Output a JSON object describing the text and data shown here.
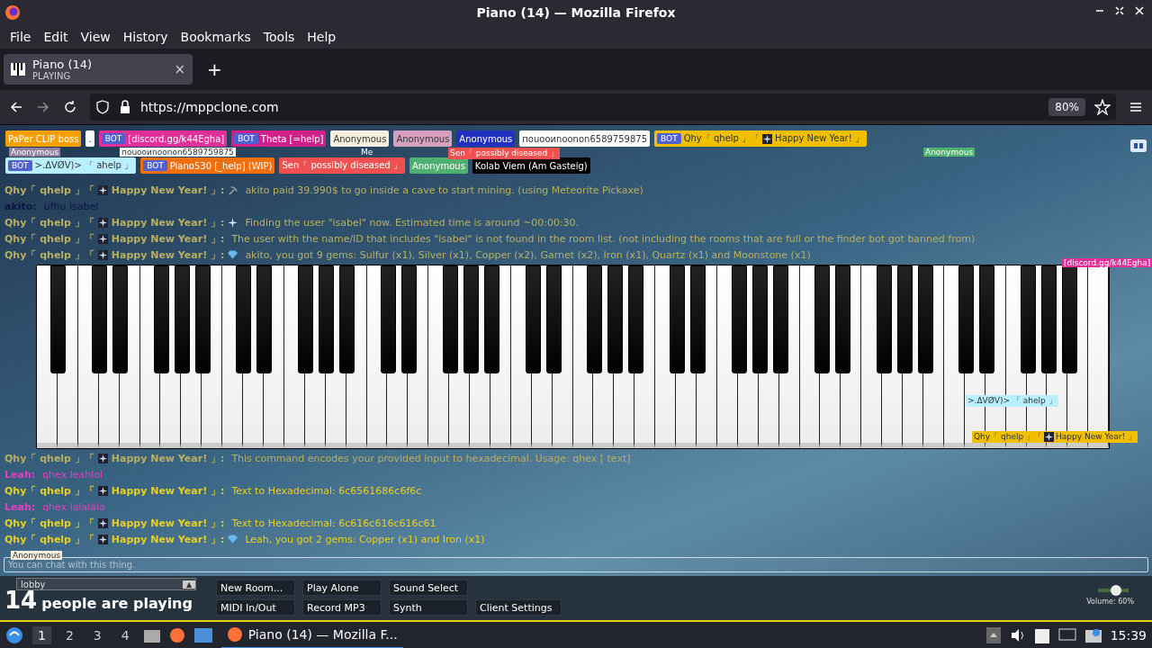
{
  "window": {
    "title": "Piano (14) — Mozilla Firefox"
  },
  "menu": [
    "File",
    "Edit",
    "View",
    "History",
    "Bookmarks",
    "Tools",
    "Help"
  ],
  "tabs": [
    {
      "title": "Piano (14)",
      "subtitle": "PLAYING",
      "selected": true,
      "close": "×"
    }
  ],
  "new_tab": "+",
  "address_bar": {
    "url": "https://mppclone.com",
    "zoom": "80%"
  },
  "users": [
    {
      "text": "PaPer CLIP boss",
      "color": "#f5a000"
    },
    {
      "text": ".",
      "color": "#ffffff"
    },
    {
      "badge": "BOT",
      "text": "[discord.gg/k44Egha]",
      "color": "#e0309a"
    },
    {
      "badge": "BOT",
      "text": "Theta [=help]",
      "color": "#d0208a"
    },
    {
      "text": "Anonymous",
      "color": "#f6efe0"
    },
    {
      "text": "Anonymous",
      "color": "#d8a0c0"
    },
    {
      "text": "Anonymous",
      "color": "#2030c0"
    },
    {
      "text": "поuооиnооnon6589759875",
      "color": "#ffffff"
    },
    {
      "badge": "BOT",
      "text": "Qhy「 qhelp 」「",
      "text_after": "Happy New Year! 」",
      "color": "#f0c000"
    },
    {
      "badge": "BOT",
      "text": ">.ΔVØV)> 「 ahelp 」",
      "color": "#b8f0ff"
    },
    {
      "badge": "BOT",
      "text": "Piano530 [_help] (WIP)",
      "color": "#f07010"
    },
    {
      "text": "Sen「 possibly diseased 」",
      "color": "#f05050"
    },
    {
      "text": "Anonymous",
      "color": "#50b070"
    },
    {
      "text": "Kolab Viem (Am Gasteig)",
      "color": "#000000"
    }
  ],
  "cursors": [
    {
      "text": "Anonymous",
      "color": "#9080a0"
    },
    {
      "text": "поuооиnооnon6589759875",
      "color": "#ffffff"
    },
    {
      "text": "Me"
    },
    {
      "text": "Sen「 possibly diseased 」",
      "color": "#f05050"
    },
    {
      "text": "Anonymous",
      "color": "#50b070"
    },
    {
      "text": "[discord.gg/k44Egha]",
      "color": "#e0309a"
    },
    {
      "text": ">.ΔVØV)> 「 ahelp 」",
      "color": "#b8f0ff"
    },
    {
      "text": "Qhy「 qhelp 」「",
      "text_after": "Happy New Year! 」",
      "color": "#f0c000"
    },
    {
      "text": "Anonymous",
      "color": "#f6efe0"
    }
  ],
  "chat_above": [
    {
      "sender": "Qhy「 qhelp 」「",
      "sender_after": "Happy New Year! 」:",
      "color": "#b8b060",
      "kind": "mining",
      "message": "akito paid 39.990$ to go inside a cave to start mining. (using Meteorite Pickaxe)"
    },
    {
      "sender": "akito:",
      "color": "#0c1448",
      "message": "ufhu isabel"
    },
    {
      "sender": "Qhy「 qhelp 」「",
      "sender_after": "Happy New Year! 」:",
      "color": "#b8b060",
      "kind": "search",
      "message": "Finding the user \"isabel\" now. Estimated time is around ~00:00:30."
    },
    {
      "sender": "Qhy「 qhelp 」「",
      "sender_after": "Happy New Year! 」:",
      "color": "#b8b060",
      "message": "The user with the name/ID that includes \"isabel\" is not found in the room list. (not including the rooms that are full or the finder bot got banned from)"
    },
    {
      "sender": "Qhy「 qhelp 」「",
      "sender_after": "Happy New Year! 」:",
      "color": "#b8b060",
      "kind": "gems",
      "message": "akito, you got 9 gems: Sulfur (x1), Silver (x1), Copper (x2), Garnet (x2), Iron (x1), Quartz (x1) and Moonstone (x1)"
    }
  ],
  "chat_below": [
    {
      "sender": "Qhy「 qhelp 」「",
      "sender_after": "Happy New Year! 」:",
      "color": "#b8b060",
      "message": "This command encodes your provided input to hexadecimal. Usage: qhex [ text]"
    },
    {
      "sender": "Leah:",
      "color": "#e040c0",
      "message": "qhex leahlol"
    },
    {
      "sender": "Qhy「 qhelp 」「",
      "sender_after": "Happy New Year! 」:",
      "color": "#e8d020",
      "message": "Text to Hexadecimal: 6c6561686c6f6c"
    },
    {
      "sender": "Leah:",
      "color": "#e040c0",
      "message": "qhex lalalala"
    },
    {
      "sender": "Qhy「 qhelp 」「",
      "sender_after": "Happy New Year! 」:",
      "color": "#e8d020",
      "message": "Text to Hexadecimal: 6c616c616c616c61"
    },
    {
      "sender": "Qhy「 qhelp 」「",
      "sender_after": "Happy New Year! 」:",
      "color": "#e8d020",
      "kind": "gems",
      "message": "Leah, you got 2 gems: Copper (x1) and Iron (x1)"
    }
  ],
  "chat_input": {
    "placeholder": "You can chat with this thing."
  },
  "room": {
    "value": "lobby",
    "arrow": "▲"
  },
  "player_count": {
    "number": "14",
    "label": "people are playing"
  },
  "buttons": [
    "New Room...",
    "Play Alone",
    "Sound Select",
    "MIDI In/Out",
    "Record MP3",
    "Synth",
    "Client Settings"
  ],
  "volume": {
    "level": 0.6,
    "label": "Volume: 60%"
  },
  "taskbar": {
    "workspaces": [
      {
        "label": "1",
        "selected": true
      },
      {
        "label": "2",
        "selected": false
      },
      {
        "label": "3",
        "selected": false
      },
      {
        "label": "4",
        "selected": false
      }
    ],
    "task": "Piano (14) — Mozilla F...",
    "clock": "15:39"
  }
}
